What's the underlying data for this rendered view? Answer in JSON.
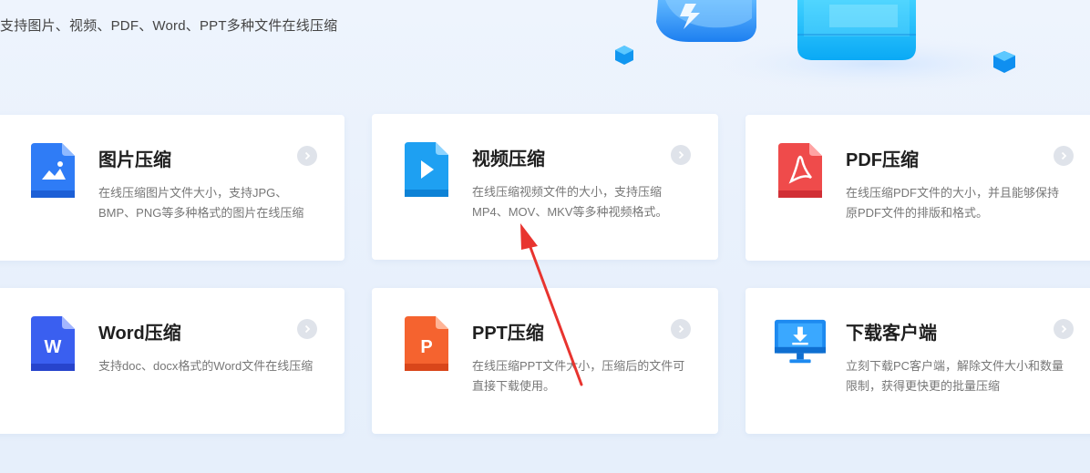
{
  "hero": {
    "subtitle": "支持图片、视频、PDF、Word、PPT多种文件在线压缩"
  },
  "cards": [
    {
      "title": "图片压缩",
      "desc": "在线压缩图片文件大小，支持JPG、BMP、PNG等多种格式的图片在线压缩",
      "icon": "image-file-icon",
      "color": "#2f7cf6"
    },
    {
      "title": "视频压缩",
      "desc": "在线压缩视频文件的大小，支持压缩MP4、MOV、MKV等多种视频格式。",
      "icon": "video-file-icon",
      "color": "#1ea0f2"
    },
    {
      "title": "PDF压缩",
      "desc": "在线压缩PDF文件的大小，并且能够保持原PDF文件的排版和格式。",
      "icon": "pdf-file-icon",
      "color": "#ef4b4b"
    },
    {
      "title": "Word压缩",
      "desc": "支持doc、docx格式的Word文件在线压缩",
      "icon": "word-file-icon",
      "color": "#3a5ff0",
      "icon_letter": "W"
    },
    {
      "title": "PPT压缩",
      "desc": "在线压缩PPT文件大小，压缩后的文件可直接下载使用。",
      "icon": "ppt-file-icon",
      "color": "#f5632f",
      "icon_letter": "P"
    },
    {
      "title": "下载客户端",
      "desc": "立刻下载PC客户端，解除文件大小和数量限制，获得更快更的批量压缩",
      "icon": "download-monitor-icon",
      "color": "#1d8af0"
    }
  ],
  "annotation": {
    "type": "red-arrow",
    "color": "#e8342f"
  }
}
